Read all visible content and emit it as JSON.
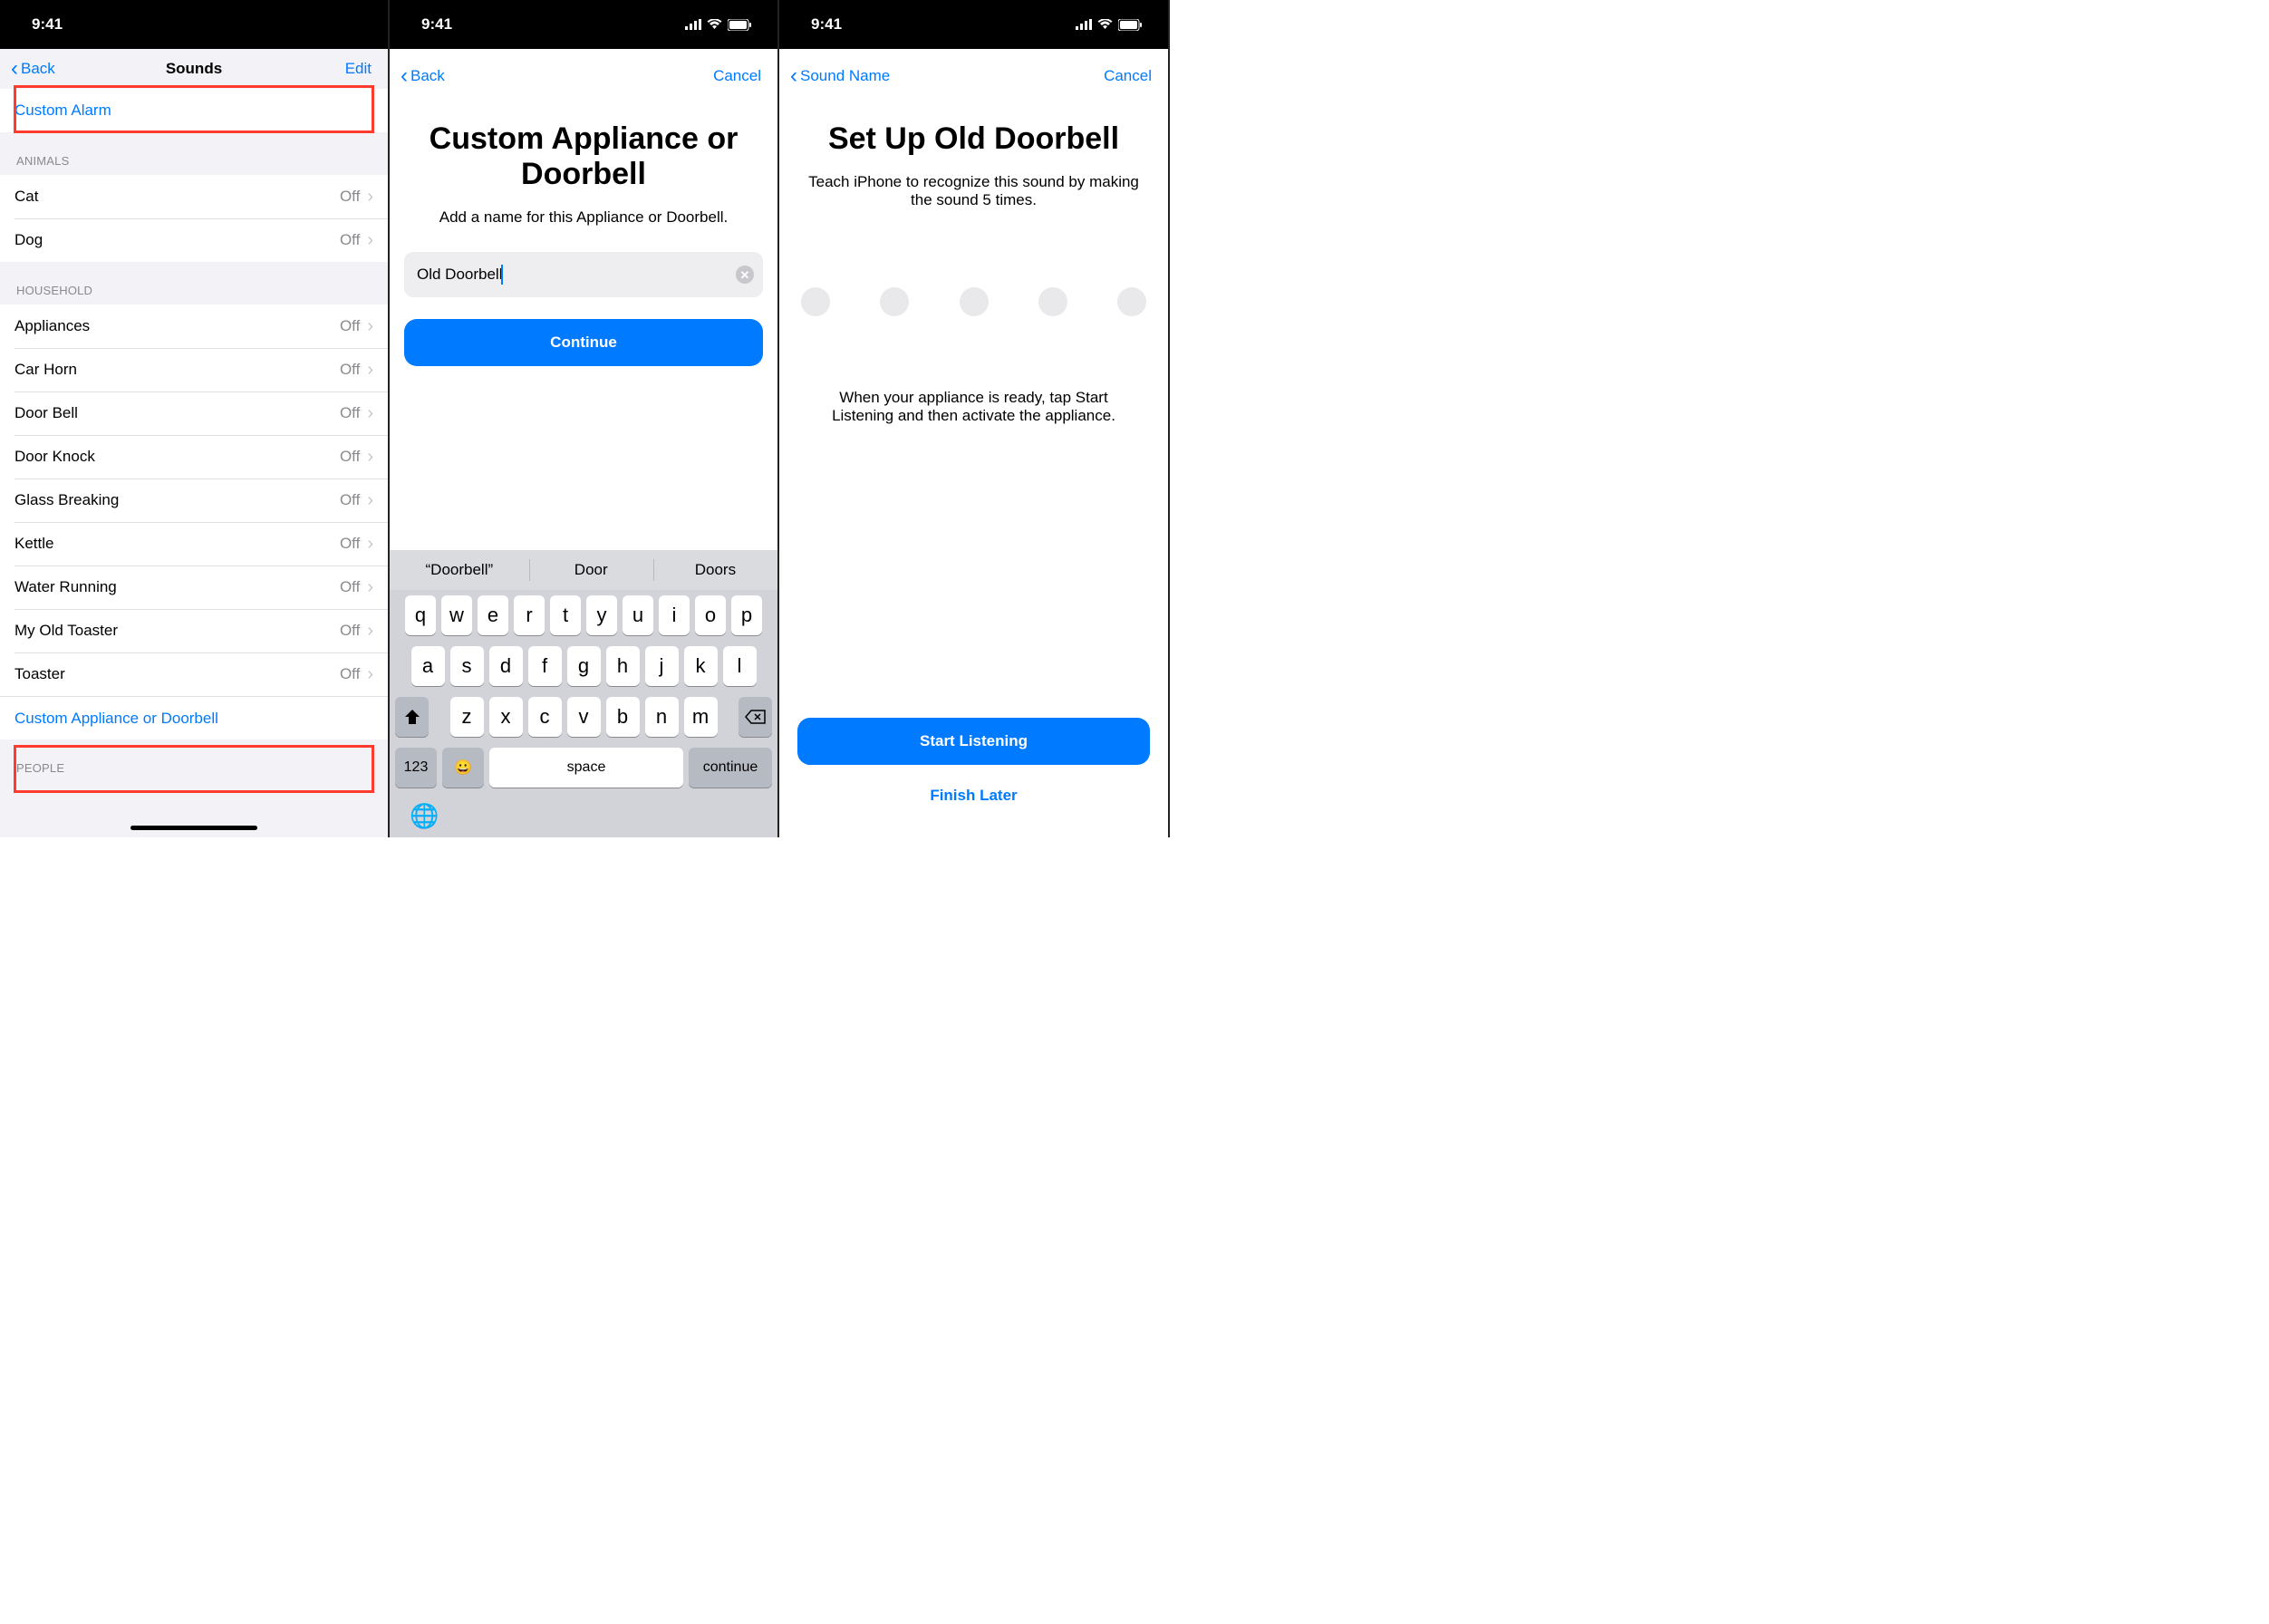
{
  "status": {
    "time": "9:41"
  },
  "s1": {
    "nav": {
      "back": "Back",
      "title": "Sounds",
      "edit": "Edit"
    },
    "custom_alarm": "Custom Alarm",
    "animals_hdr": "ANIMALS",
    "animals": [
      {
        "label": "Cat",
        "val": "Off"
      },
      {
        "label": "Dog",
        "val": "Off"
      }
    ],
    "household_hdr": "HOUSEHOLD",
    "household": [
      {
        "label": "Appliances",
        "val": "Off"
      },
      {
        "label": "Car Horn",
        "val": "Off"
      },
      {
        "label": "Door Bell",
        "val": "Off"
      },
      {
        "label": "Door Knock",
        "val": "Off"
      },
      {
        "label": "Glass Breaking",
        "val": "Off"
      },
      {
        "label": "Kettle",
        "val": "Off"
      },
      {
        "label": "Water Running",
        "val": "Off"
      },
      {
        "label": "My Old Toaster",
        "val": "Off"
      },
      {
        "label": "Toaster",
        "val": "Off"
      }
    ],
    "custom_appl": "Custom Appliance or Doorbell",
    "people_hdr": "PEOPLE"
  },
  "s2": {
    "nav": {
      "back": "Back",
      "cancel": "Cancel"
    },
    "title": "Custom Appliance or Doorbell",
    "subtitle": "Add a name for this Appliance or Doorbell.",
    "input_value": "Old Doorbell",
    "continue": "Continue",
    "suggestions": [
      "“Doorbell”",
      "Door",
      "Doors"
    ],
    "kb_123": "123",
    "kb_space": "space",
    "kb_continue": "continue",
    "row1": [
      "q",
      "w",
      "e",
      "r",
      "t",
      "y",
      "u",
      "i",
      "o",
      "p"
    ],
    "row2": [
      "a",
      "s",
      "d",
      "f",
      "g",
      "h",
      "j",
      "k",
      "l"
    ],
    "row3": [
      "z",
      "x",
      "c",
      "v",
      "b",
      "n",
      "m"
    ]
  },
  "s3": {
    "nav": {
      "back": "Sound Name",
      "cancel": "Cancel"
    },
    "title": "Set Up Old Doorbell",
    "subtitle": "Teach iPhone to recognize this sound by making the sound 5 times.",
    "instr": "When your appliance is ready, tap Start Listening and then activate the appliance.",
    "start": "Start Listening",
    "finish": "Finish Later"
  }
}
